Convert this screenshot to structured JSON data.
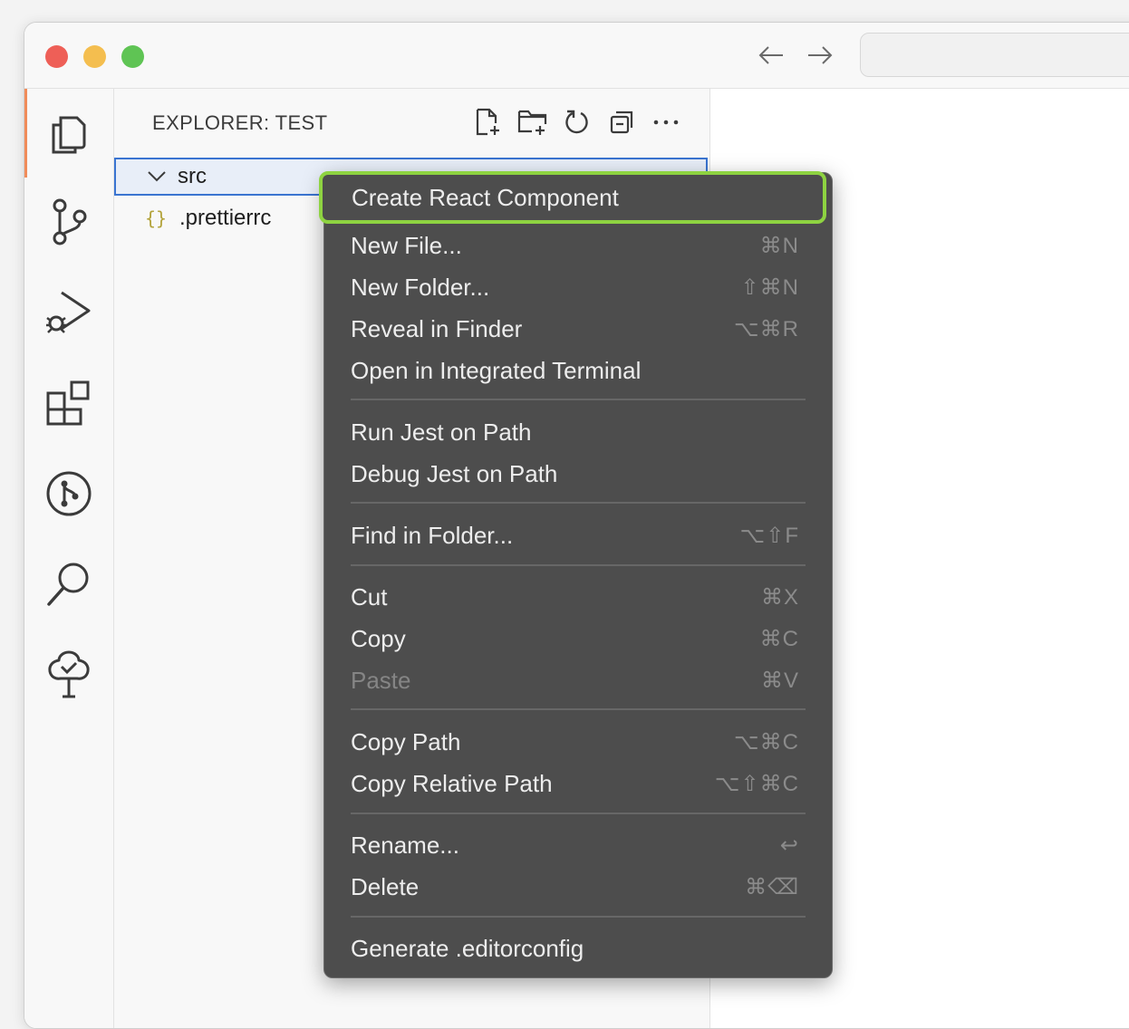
{
  "sidebar": {
    "title": "EXPLORER: TEST",
    "tree": [
      {
        "label": "src",
        "type": "folder",
        "expanded": true
      },
      {
        "label": ".prettierrc",
        "type": "json",
        "icon_glyph": "{}"
      }
    ]
  },
  "menu": {
    "items": [
      {
        "label": "Create React Component",
        "key": ""
      },
      {
        "label": "New File...",
        "key": "⌘N"
      },
      {
        "label": "New Folder...",
        "key": "⇧⌘N"
      },
      {
        "label": "Reveal in Finder",
        "key": "⌥⌘R"
      },
      {
        "label": "Open in Integrated Terminal",
        "key": ""
      },
      {
        "label": "Run Jest on Path",
        "key": ""
      },
      {
        "label": "Debug Jest on Path",
        "key": ""
      },
      {
        "label": "Find in Folder...",
        "key": "⌥⇧F"
      },
      {
        "label": "Cut",
        "key": "⌘X"
      },
      {
        "label": "Copy",
        "key": "⌘C"
      },
      {
        "label": "Paste",
        "key": "⌘V",
        "disabled": true
      },
      {
        "label": "Copy Path",
        "key": "⌥⌘C"
      },
      {
        "label": "Copy Relative Path",
        "key": "⌥⇧⌘C"
      },
      {
        "label": "Rename...",
        "key": "↩"
      },
      {
        "label": "Delete",
        "key": "⌘⌫"
      },
      {
        "label": "Generate .editorconfig",
        "key": ""
      }
    ]
  },
  "colors": {
    "highlight_border": "#8ed341",
    "menu_bg": "#4d4d4d",
    "selection_outline": "#3a74d1",
    "active_indicator": "#f08c5a"
  }
}
